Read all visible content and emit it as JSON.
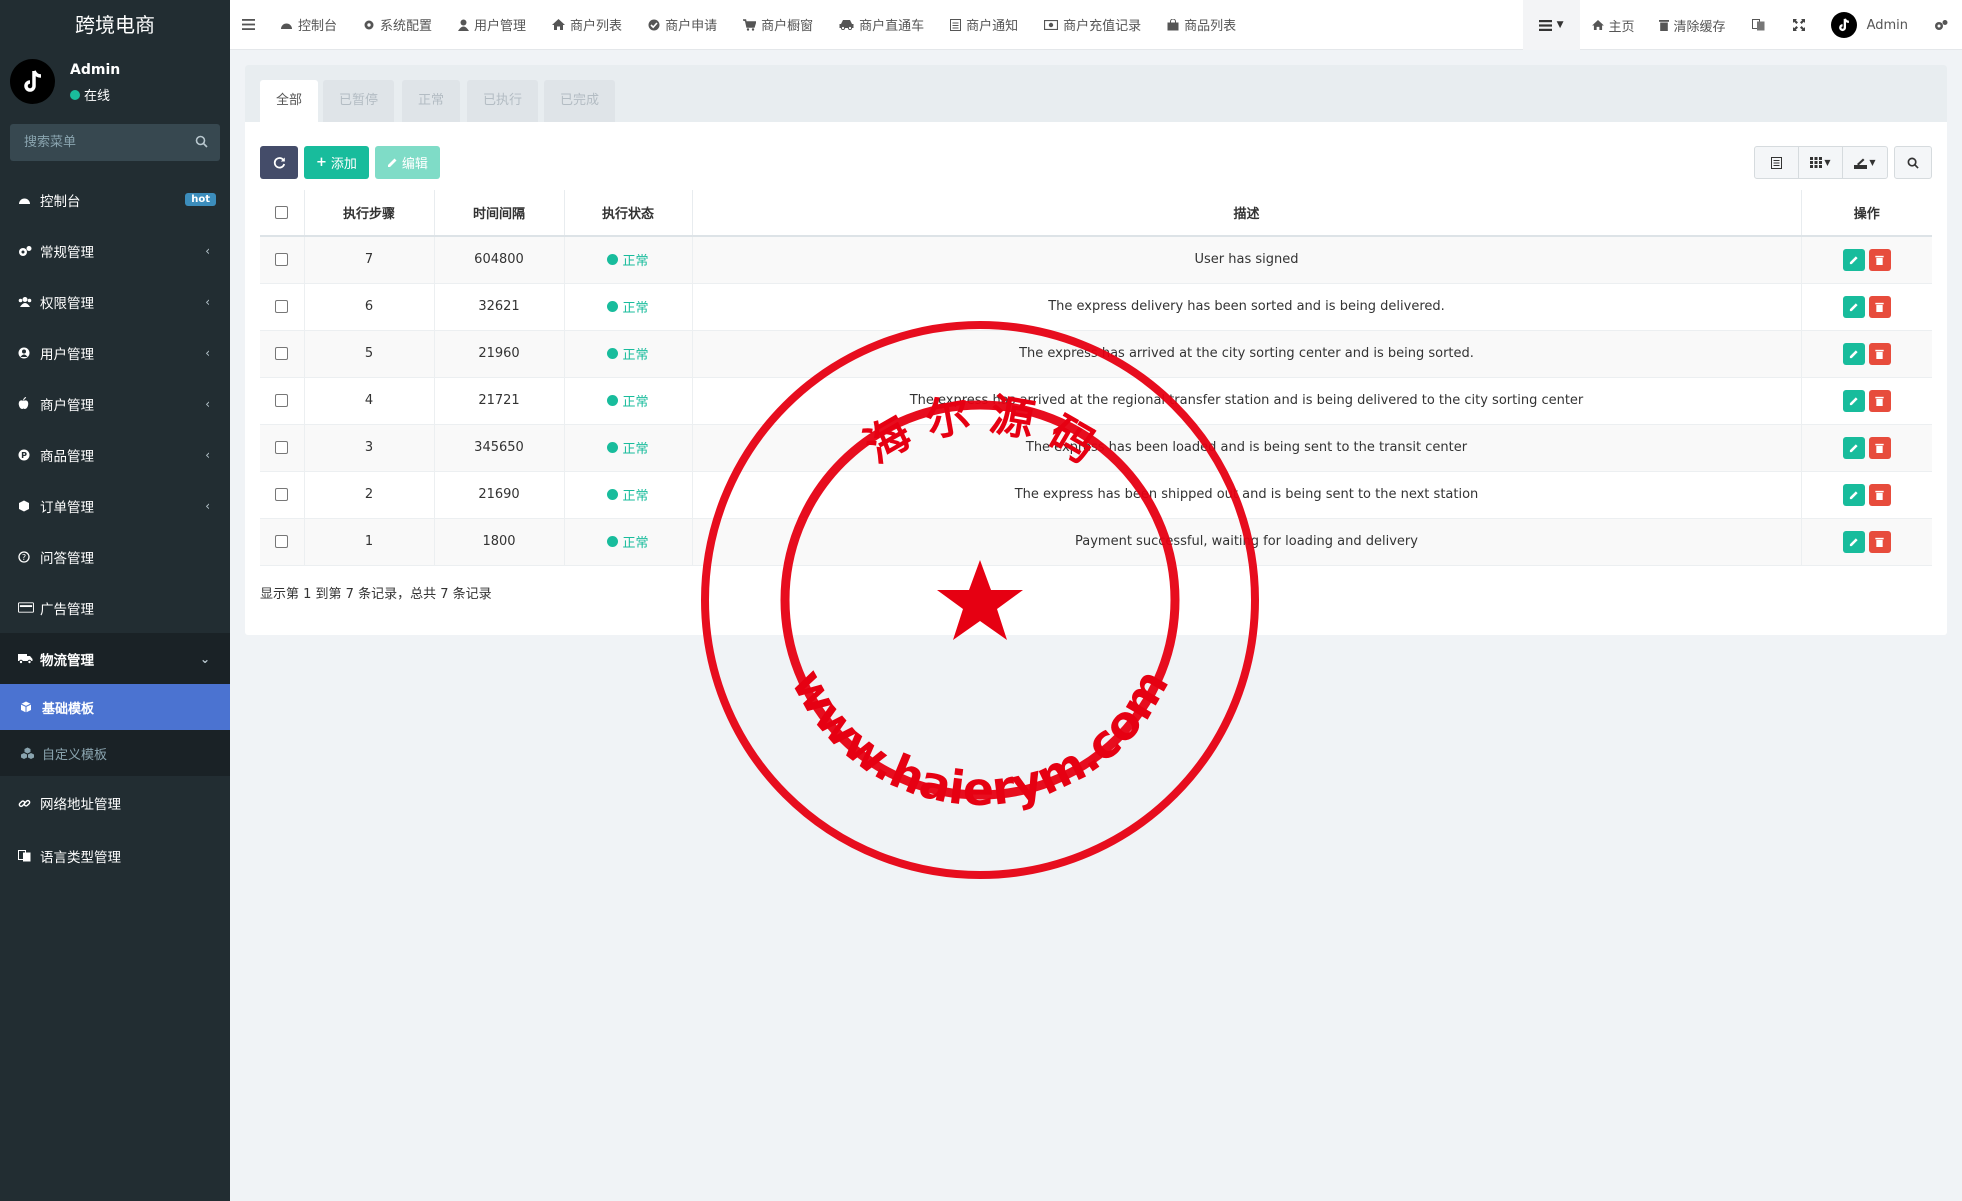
{
  "app": {
    "brand": "跨境电商"
  },
  "user": {
    "name": "Admin",
    "status": "在线"
  },
  "sidebar": {
    "search_placeholder": "搜索菜单",
    "hot_badge": "hot",
    "items": [
      {
        "label": "控制台",
        "icon": "dashboard-icon"
      },
      {
        "label": "常规管理",
        "icon": "cogs-icon"
      },
      {
        "label": "权限管理",
        "icon": "group-icon"
      },
      {
        "label": "用户管理",
        "icon": "user-circle-icon"
      },
      {
        "label": "商户管理",
        "icon": "apple-icon"
      },
      {
        "label": "商品管理",
        "icon": "product-icon"
      },
      {
        "label": "订单管理",
        "icon": "cube-icon"
      },
      {
        "label": "问答管理",
        "icon": "question-icon"
      },
      {
        "label": "广告管理",
        "icon": "ad-icon"
      },
      {
        "label": "物流管理",
        "icon": "truck-icon"
      }
    ],
    "sub_items": [
      {
        "label": "基础模板",
        "icon": "cube-icon"
      },
      {
        "label": "自定义模板",
        "icon": "cubes-icon"
      }
    ],
    "after_items": [
      {
        "label": "网络地址管理",
        "icon": "link-icon"
      },
      {
        "label": "语言类型管理",
        "icon": "language-icon"
      }
    ]
  },
  "topnav": {
    "items": [
      "控制台",
      "系统配置",
      "用户管理",
      "商户列表",
      "商户申请",
      "商户橱窗",
      "商户直通车",
      "商户通知",
      "商户充值记录",
      "商品列表"
    ],
    "home": "主页",
    "clear_cache": "清除缓存",
    "admin": "Admin"
  },
  "tabs": [
    "全部",
    "已暂停",
    "正常",
    "已执行",
    "已完成"
  ],
  "toolbar": {
    "add": "添加",
    "edit": "编辑"
  },
  "table": {
    "headers": [
      "执行步骤",
      "时间间隔",
      "执行状态",
      "描述",
      "操作"
    ],
    "rows": [
      {
        "step": "7",
        "interval": "604800",
        "status": "正常",
        "desc": "User has signed"
      },
      {
        "step": "6",
        "interval": "32621",
        "status": "正常",
        "desc": "The express delivery has been sorted and is being delivered."
      },
      {
        "step": "5",
        "interval": "21960",
        "status": "正常",
        "desc": "The express has arrived at the city sorting center and is being sorted."
      },
      {
        "step": "4",
        "interval": "21721",
        "status": "正常",
        "desc": "The express has arrived at the regional transfer station and is being delivered to the city sorting center"
      },
      {
        "step": "3",
        "interval": "345650",
        "status": "正常",
        "desc": "The express has been loaded and is being sent to the transit center"
      },
      {
        "step": "2",
        "interval": "21690",
        "status": "正常",
        "desc": "The express has been shipped out and is being sent to the next station"
      },
      {
        "step": "1",
        "interval": "1800",
        "status": "正常",
        "desc": "Payment successful, waiting for loading and delivery"
      }
    ]
  },
  "pager": "显示第 1 到第 7 条记录，总共 7 条记录",
  "stamp": {
    "top_text": "海 尔 源 码",
    "bottom_text": "www.haierym.com",
    "color": "#e60012"
  }
}
